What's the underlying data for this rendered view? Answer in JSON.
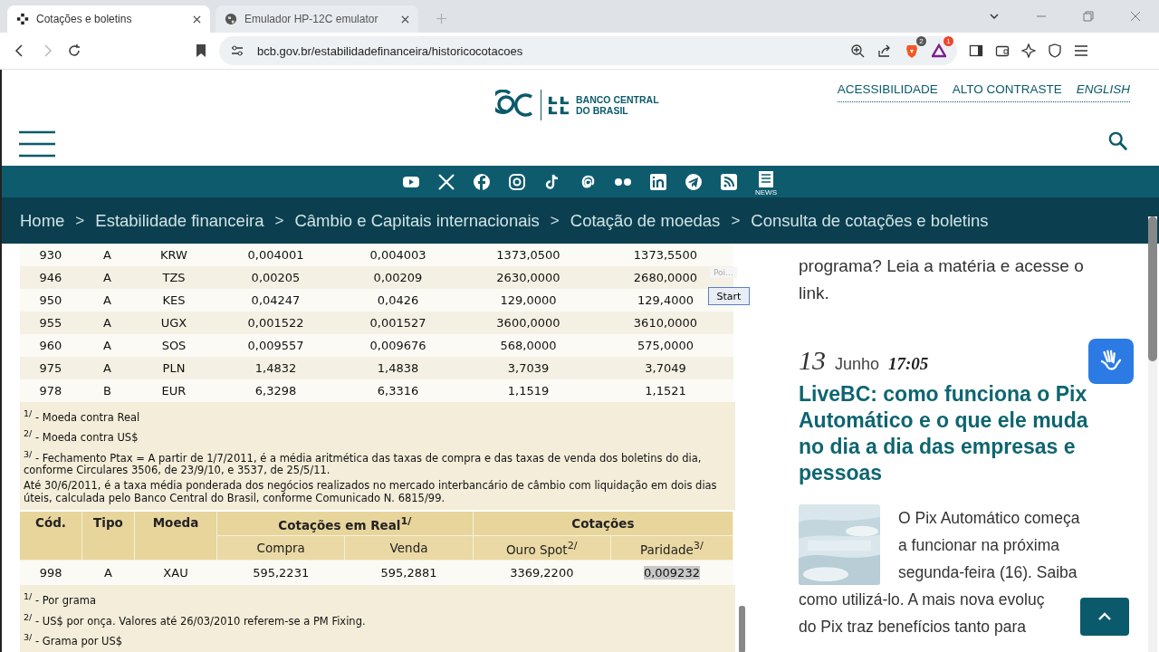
{
  "browser": {
    "tabs": [
      {
        "title": "Cotações e boletins",
        "selected": true
      },
      {
        "title": "Emulador HP-12C emulator",
        "selected": false
      }
    ],
    "url": "bcb.gov.br/estabilidadefinanceira/historicocotacoes",
    "extension_badges": [
      "2",
      "1"
    ]
  },
  "header": {
    "links": [
      {
        "label": "ACESSIBILIDADE",
        "italic": false
      },
      {
        "label": "ALTO CONTRASTE",
        "italic": false
      },
      {
        "label": "ENGLISH",
        "italic": true
      }
    ],
    "logo_lines": [
      "BANCO CENTRAL",
      "DO BRASIL"
    ],
    "news_label": "NEWS"
  },
  "breadcrumb": [
    {
      "label": "Home"
    },
    {
      "separator": ">",
      "label": "Estabilidade financeira"
    },
    {
      "separator": ">",
      "label": "Câmbio e Capitais internacionais"
    },
    {
      "separator": ">",
      "label": "Cotação de moedas"
    },
    {
      "separator": ">",
      "label": "Consulta de cotações e boletins"
    }
  ],
  "currency_table": {
    "rows": [
      [
        "930",
        "A",
        "KRW",
        "0,004001",
        "0,004003",
        "1373,0500",
        "1373,5500"
      ],
      [
        "946",
        "A",
        "TZS",
        "0,00205",
        "0,00209",
        "2630,0000",
        "2680,0000"
      ],
      [
        "950",
        "A",
        "KES",
        "0,04247",
        "0,0426",
        "129,0000",
        "129,4000"
      ],
      [
        "955",
        "A",
        "UGX",
        "0,001522",
        "0,001527",
        "3600,0000",
        "3610,0000"
      ],
      [
        "960",
        "A",
        "SOS",
        "0,009557",
        "0,009676",
        "568,0000",
        "575,0000"
      ],
      [
        "975",
        "A",
        "PLN",
        "1,4832",
        "1,4838",
        "3,7039",
        "3,7049"
      ],
      [
        "978",
        "B",
        "EUR",
        "6,3298",
        "6,3316",
        "1,1519",
        "1,1521"
      ]
    ],
    "notes": [
      "$^{1/}$ - Moeda contra Real",
      "$^{2/}$ - Moeda contra US$",
      "$^{3/}$ - Fechamento Ptax = A partir de 1/7/2011, é a média aritmética das taxas de compra e das taxas de venda dos boletins do dia, conforme Circulares 3506, de 23/9/10, e 3537, de 25/5/11.",
      "Até 30/6/2011, é a taxa média ponderada dos negócios realizados no mercado interbancário de câmbio com liquidação em dois dias úteis, calculada pelo Banco Central do Brasil, conforme Comunicado N. 6815/99."
    ]
  },
  "overlay": {
    "hint": "Poi...",
    "button": "Start"
  },
  "gold_table": {
    "columns": [
      "Cód.",
      "Tipo",
      "Moeda"
    ],
    "groups": [
      "Cotações em Real$^{1/}$",
      "Cotações"
    ],
    "subcolumns": [
      "Compra",
      "Venda",
      "Ouro Spot$^{2/}$",
      "Paridade$^{3/}$"
    ],
    "row": [
      {
        "text": "998",
        "selected": false
      },
      {
        "text": "A",
        "selected": false
      },
      {
        "text": "XAU",
        "selected": false
      },
      {
        "text": "595,2231",
        "selected": false
      },
      {
        "text": "595,2881",
        "selected": false
      },
      {
        "text": "3369,2200",
        "selected": false
      },
      {
        "text": "0,009232",
        "selected": true
      }
    ],
    "notes": [
      "$^{1/}$ - Por grama",
      "$^{2/}$ - US$ por onça. Valores até 26/03/2010 referem-se a PM Fixing.",
      "$^{3/}$ - Grama por US$"
    ]
  },
  "news": {
    "previous_excerpt": [
      "programa? Leia a matéria e acesse o",
      "link."
    ],
    "day": "13",
    "month": "Junho",
    "time": "17:05",
    "title": "LiveBC: como funciona o Pix Automático e o que ele muda no dia a dia das empresas e pessoas",
    "thumbnail": {
      "kind": "picture"
    },
    "body": [
      "O Pix Automático começa",
      "a funcionar na próxima",
      "segunda-feira (16). Saiba",
      "como utilizá-lo. A mais nova evoluç",
      "do Pix traz benefícios tanto para"
    ]
  }
}
